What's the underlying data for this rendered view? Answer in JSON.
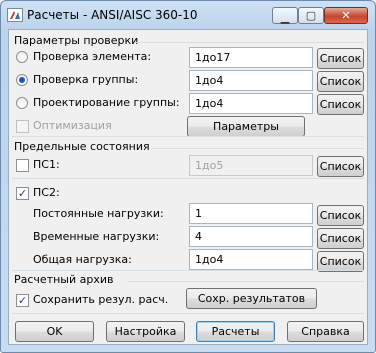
{
  "window": {
    "title": "Расчеты - ANSI/AISC 360-10"
  },
  "check_params": {
    "title": "Параметры проверки",
    "options": [
      {
        "label": "Проверка элемента:",
        "value": "1до17",
        "list_label": "Список",
        "selected": false
      },
      {
        "label": "Проверка группы:",
        "value": "1до4",
        "list_label": "Список",
        "selected": true
      },
      {
        "label": "Проектирование группы:",
        "value": "1до4",
        "list_label": "Список",
        "selected": false
      }
    ],
    "optimization_label": "Оптимизация",
    "params_button": "Параметры"
  },
  "limit_states": {
    "title": "Предельные состояния",
    "ps1": {
      "label": "ПС1:",
      "value": "1до5",
      "list_label": "Список",
      "checked": false
    },
    "ps2": {
      "label": "ПС2:",
      "checked": true
    },
    "rows": [
      {
        "label": "Постоянные нагрузки:",
        "value": "1",
        "list_label": "Список"
      },
      {
        "label": "Временные нагрузки:",
        "value": "4",
        "list_label": "Список"
      },
      {
        "label": "Общая нагрузка:",
        "value": "1до4",
        "list_label": "Список"
      }
    ]
  },
  "archive": {
    "title": "Расчетный архив",
    "save_label": "Сохранить резул. расч.",
    "save_checked": true,
    "save_results_button": "Сохр. результатов"
  },
  "footer": {
    "ok": "OK",
    "setup": "Настройка",
    "calc": "Расчеты",
    "help": "Справка"
  },
  "checkmark": "✓"
}
